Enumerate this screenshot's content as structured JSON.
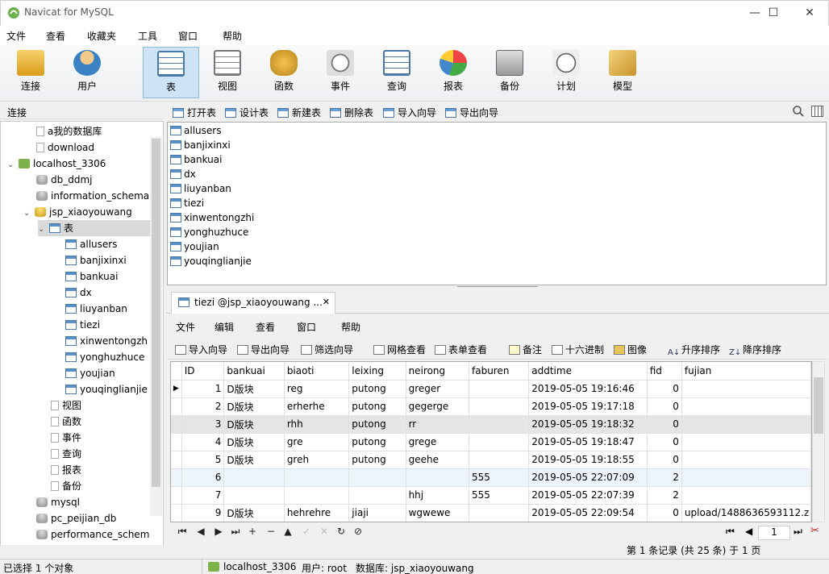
{
  "window": {
    "title": "Navicat for MySQL",
    "minimize": "—",
    "maximize": "☐",
    "close": "✕"
  },
  "menu": [
    "文件",
    "查看",
    "收藏夹",
    "工具",
    "窗口",
    "帮助"
  ],
  "toolbar": [
    {
      "label": "连接",
      "icon": "connect-icon"
    },
    {
      "label": "用户",
      "icon": "user-icon"
    },
    {
      "label": "表",
      "icon": "table-icon",
      "active": true
    },
    {
      "label": "视图",
      "icon": "view-icon"
    },
    {
      "label": "函数",
      "icon": "function-icon"
    },
    {
      "label": "事件",
      "icon": "event-icon"
    },
    {
      "label": "查询",
      "icon": "query-icon"
    },
    {
      "label": "报表",
      "icon": "report-icon"
    },
    {
      "label": "备份",
      "icon": "backup-icon"
    },
    {
      "label": "计划",
      "icon": "schedule-icon"
    },
    {
      "label": "模型",
      "icon": "model-icon"
    }
  ],
  "connection_header": "连接",
  "tree": [
    {
      "label": "a我的数据库",
      "kind": "plain",
      "level": 1
    },
    {
      "label": "download",
      "kind": "plain",
      "level": 1
    },
    {
      "label": "localhost_3306",
      "kind": "conn",
      "level": 0,
      "arrow": "⌄"
    },
    {
      "label": "db_ddmj",
      "kind": "db",
      "level": 1
    },
    {
      "label": "information_schema",
      "kind": "db",
      "level": 1
    },
    {
      "label": "jsp_xiaoyouwang",
      "kind": "db-y",
      "level": 1,
      "arrow": "⌄"
    },
    {
      "label": "表",
      "kind": "tbl",
      "level": 2,
      "arrow": "⌄",
      "selected": true
    },
    {
      "label": "allusers",
      "kind": "tbl",
      "level": 3
    },
    {
      "label": "banjixinxi",
      "kind": "tbl",
      "level": 3
    },
    {
      "label": "bankuai",
      "kind": "tbl",
      "level": 3
    },
    {
      "label": "dx",
      "kind": "tbl",
      "level": 3
    },
    {
      "label": "liuyanban",
      "kind": "tbl",
      "level": 3
    },
    {
      "label": "tiezi",
      "kind": "tbl",
      "level": 3
    },
    {
      "label": "xinwentongzh",
      "kind": "tbl",
      "level": 3
    },
    {
      "label": "yonghuzhuce",
      "kind": "tbl",
      "level": 3
    },
    {
      "label": "youjian",
      "kind": "tbl",
      "level": 3
    },
    {
      "label": "youqinglianjie",
      "kind": "tbl",
      "level": 3
    },
    {
      "label": "视图",
      "kind": "view",
      "level": 2
    },
    {
      "label": "函数",
      "kind": "func",
      "level": 2
    },
    {
      "label": "事件",
      "kind": "event",
      "level": 2
    },
    {
      "label": "查询",
      "kind": "query",
      "level": 2
    },
    {
      "label": "报表",
      "kind": "report",
      "level": 2
    },
    {
      "label": "备份",
      "kind": "backup",
      "level": 2
    },
    {
      "label": "mysql",
      "kind": "db",
      "level": 1
    },
    {
      "label": "pc_peijian_db",
      "kind": "db",
      "level": 1
    },
    {
      "label": "performance_schem",
      "kind": "db",
      "level": 1
    }
  ],
  "object_toolbar": [
    "打开表",
    "设计表",
    "新建表",
    "删除表",
    "导入向导",
    "导出向导"
  ],
  "objects": [
    "allusers",
    "banjixinxi",
    "bankuai",
    "dx",
    "liuyanban",
    "tiezi",
    "xinwentongzhi",
    "yonghuzhuce",
    "youjian",
    "youqinglianjie"
  ],
  "tab": {
    "label": "tiezi @jsp_xiaoyouwang ...",
    "close": "✕"
  },
  "sub_menu": [
    "文件",
    "编辑",
    "查看",
    "窗口",
    "帮助"
  ],
  "sub_toolbar": [
    "导入向导",
    "导出向导",
    "筛选向导",
    "网格查看",
    "表单查看",
    "备注",
    "十六进制",
    "图像",
    "升序排序",
    "降序排序"
  ],
  "grid": {
    "columns": [
      "ID",
      "bankuai",
      "biaoti",
      "leixing",
      "neirong",
      "faburen",
      "addtime",
      "fid",
      "fujian"
    ],
    "rows": [
      [
        "1",
        "D版块",
        "reg",
        "putong",
        "greger",
        "",
        "2019-05-05 19:16:46",
        "0",
        ""
      ],
      [
        "2",
        "D版块",
        "erherhe",
        "putong",
        "gegerge",
        "",
        "2019-05-05 19:17:18",
        "0",
        ""
      ],
      [
        "3",
        "D版块",
        "rhh",
        "putong",
        "rr",
        "",
        "2019-05-05 19:18:32",
        "0",
        ""
      ],
      [
        "4",
        "D版块",
        "gre",
        "putong",
        "grege",
        "",
        "2019-05-05 19:18:47",
        "0",
        ""
      ],
      [
        "5",
        "D版块",
        "greh",
        "putong",
        "geehe",
        "",
        "2019-05-05 19:18:55",
        "0",
        ""
      ],
      [
        "6",
        "",
        "",
        "",
        "",
        "555",
        "2019-05-05 22:07:09",
        "2",
        ""
      ],
      [
        "7",
        "",
        "",
        "",
        "hhj",
        "555",
        "2019-05-05 22:07:39",
        "2",
        ""
      ],
      [
        "9",
        "D版块",
        "hehrehre",
        "jiaji",
        "wgwewe",
        "",
        "2019-05-05 22:09:54",
        "0",
        "upload/1488636593112.z"
      ]
    ]
  },
  "nav_buttons": [
    "⏮",
    "◀",
    "▶",
    "⏭",
    "+",
    "−",
    "▲",
    "✓",
    "✕",
    "↻",
    "⊘"
  ],
  "page": {
    "current": "1",
    "record_info": "第 1 条记录 (共 25 条) 于 1 页"
  },
  "status": {
    "selection": "已选择 1 个对象",
    "connection": "localhost_3306",
    "user": "用户: root",
    "database": "数据库: jsp_xiaoyouwang"
  }
}
